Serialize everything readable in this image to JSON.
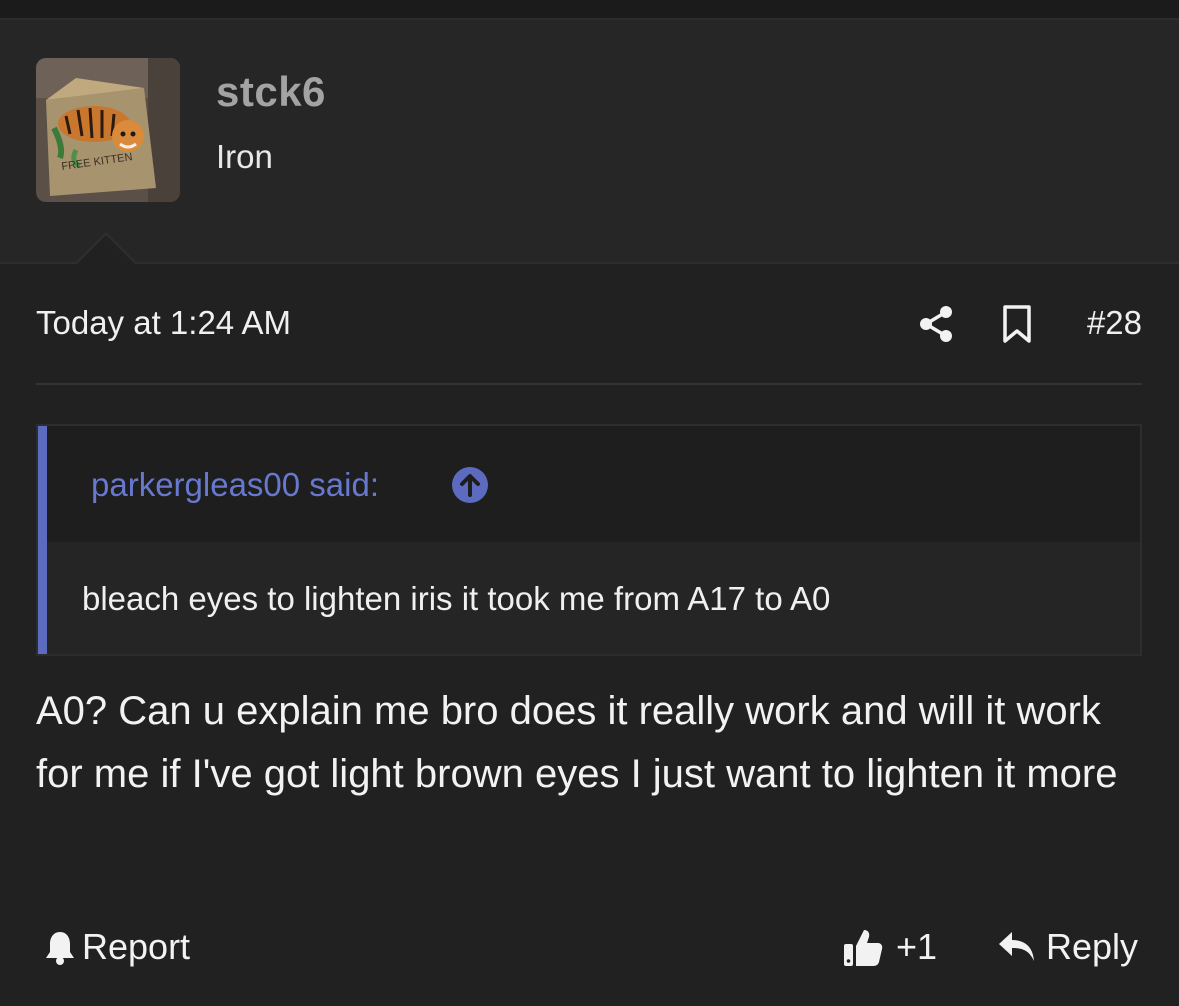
{
  "user": {
    "username": "stck6",
    "title": "Iron",
    "avatar_text": "FREE KITTEN"
  },
  "post": {
    "timestamp": "Today at 1:24 AM",
    "number": "#28",
    "quote": {
      "author": "parkergleas00 said:",
      "text": "bleach eyes to lighten iris it took me from A17 to A0"
    },
    "body": "A0? Can u explain me bro does it really work and will it work for me if I've got light brown eyes I just want to lighten it more"
  },
  "actions": {
    "report_label": "Report",
    "like_label": "+1",
    "reply_label": "Reply"
  },
  "colors": {
    "background": "#212121",
    "quote_accent": "#5c6bc0",
    "username": "#a3a3a3"
  },
  "icons": [
    "share-icon",
    "bookmark-icon",
    "arrow-up-circle-icon",
    "bell-icon",
    "thumbs-up-icon",
    "reply-arrow-icon"
  ]
}
